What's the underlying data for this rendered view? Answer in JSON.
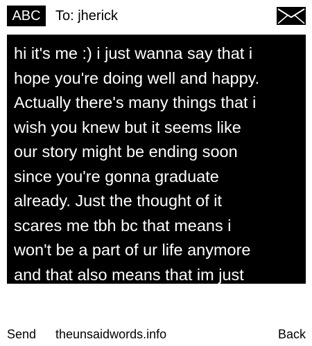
{
  "header": {
    "mode_label": "ABC",
    "to_label": "To: jherick",
    "envelope_icon": "envelope-icon"
  },
  "message": {
    "body": "hi it's me :) i just wanna say that i\nhope you're doing well and happy.\nActually there's many things that i\nwish you knew but it seems like\nour story might be ending soon\nsince you're gonna graduate\nalready. Just the thought of it\nscares me tbh bc that means i\nwon't be a part of ur life anymore\nand that also means that im just"
  },
  "footer": {
    "send_label": "Send",
    "site_label": "theunsaidwords.info",
    "back_label": "Back"
  },
  "colors": {
    "background": "#ffffff",
    "message_background": "#000000",
    "message_text": "#ffffff",
    "text": "#000000"
  }
}
